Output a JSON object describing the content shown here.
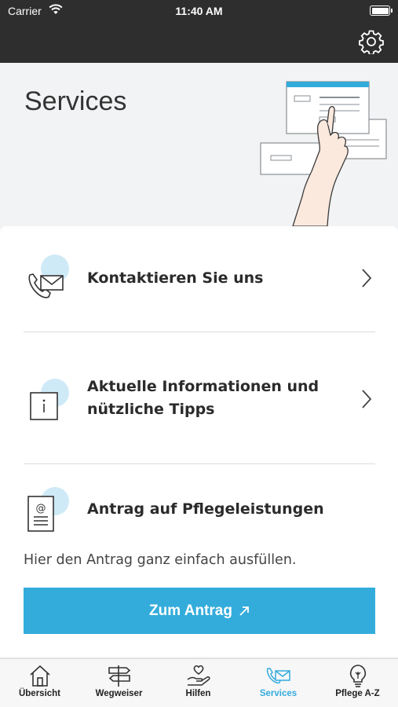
{
  "status_bar": {
    "carrier": "Carrier",
    "time": "11:40 AM"
  },
  "header": {
    "settings_icon": "gear-icon"
  },
  "hero": {
    "title": "Services"
  },
  "services": [
    {
      "label": "Kontaktieren Sie uns",
      "icon": "phone-mail-icon"
    },
    {
      "label_line1": "Aktuelle Informationen und",
      "label_line2": "nützliche Tipps",
      "icon": "info-icon"
    },
    {
      "label": "Antrag auf Pflegeleistungen",
      "icon": "document-at-icon",
      "description": "Hier den Antrag ganz einfach ausfüllen.",
      "button_label": "Zum Antrag"
    }
  ],
  "tabs": [
    {
      "label": "Übersicht",
      "icon": "house-icon"
    },
    {
      "label": "Wegweiser",
      "icon": "signpost-icon"
    },
    {
      "label": "Hilfen",
      "icon": "heart-hand-icon"
    },
    {
      "label": "Services",
      "icon": "phone-mail-icon",
      "active": true
    },
    {
      "label": "Pflege A-Z",
      "icon": "lightbulb-icon"
    }
  ],
  "colors": {
    "accent": "#33acdc",
    "topbar": "#2e2e2e",
    "hero_bg": "#f2f3f4",
    "icon_bubble": "#cfeaf7"
  }
}
